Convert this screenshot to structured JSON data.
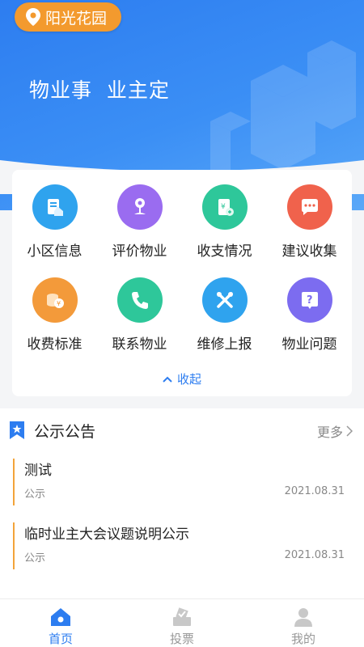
{
  "header": {
    "community_name": "阳光花园",
    "slogan": "物业事  业主定"
  },
  "menu": {
    "items": [
      {
        "label": "小区信息",
        "icon": "building-doc-icon",
        "color": "#2fa3ee"
      },
      {
        "label": "评价物业",
        "icon": "flower-rating-icon",
        "color": "#9a6cf0"
      },
      {
        "label": "收支情况",
        "icon": "ledger-icon",
        "color": "#2ec79a"
      },
      {
        "label": "建议收集",
        "icon": "chat-bubble-icon",
        "color": "#f0624c"
      },
      {
        "label": "收费标准",
        "icon": "coin-yen-icon",
        "color": "#f39a3a"
      },
      {
        "label": "联系物业",
        "icon": "phone-icon",
        "color": "#2ec79a"
      },
      {
        "label": "维修上报",
        "icon": "tools-icon",
        "color": "#2fa3ee"
      },
      {
        "label": "物业问题",
        "icon": "question-icon",
        "color": "#7c6cf0"
      }
    ],
    "collapse_label": "收起"
  },
  "notices": {
    "title": "公示公告",
    "more_label": "更多",
    "items": [
      {
        "title": "测试",
        "category": "公示",
        "date": "2021.08.31"
      },
      {
        "title": "临时业主大会议题说明公示",
        "category": "公示",
        "date": "2021.08.31"
      }
    ]
  },
  "tabbar": {
    "tabs": [
      {
        "label": "首页",
        "icon": "home-icon",
        "active": true
      },
      {
        "label": "投票",
        "icon": "vote-box-icon",
        "active": false
      },
      {
        "label": "我的",
        "icon": "user-icon",
        "active": false
      }
    ]
  },
  "colors": {
    "primary": "#2d7df0",
    "accent_orange": "#f39a2e"
  }
}
